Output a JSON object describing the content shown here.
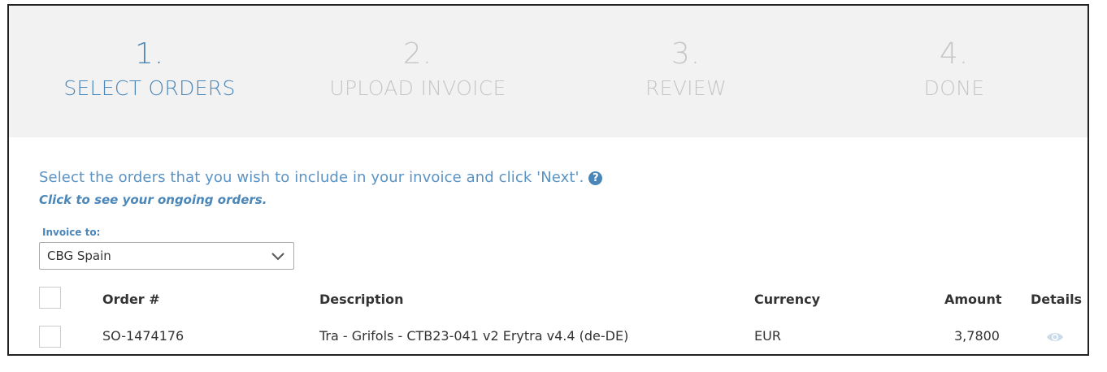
{
  "steps": [
    {
      "number": "1.",
      "label": "SELECT ORDERS",
      "active": true
    },
    {
      "number": "2.",
      "label": "UPLOAD INVOICE",
      "active": false
    },
    {
      "number": "3.",
      "label": "REVIEW",
      "active": false
    },
    {
      "number": "4.",
      "label": "DONE",
      "active": false
    }
  ],
  "intro": {
    "text": "Select the orders that you wish to include in your invoice and click 'Next'.",
    "help_icon": "question-circle-icon",
    "ongoing_link": "Click to see your ongoing orders."
  },
  "invoice_to": {
    "label": "Invoice to:",
    "selected": "CBG Spain"
  },
  "table": {
    "headers": {
      "order": "Order #",
      "description": "Description",
      "currency": "Currency",
      "amount": "Amount",
      "details": "Details"
    },
    "rows": [
      {
        "order": "SO-1474176",
        "description": "Tra - Grifols - CTB23-041 v2 Erytra v4.4 (de-DE)",
        "currency": "EUR",
        "amount": "3,7800",
        "details_icon": "eye-icon"
      }
    ]
  },
  "colors": {
    "accent": "#4a86b8",
    "inactive_step": "#c6c6c6",
    "steps_bg": "#f2f2f2"
  }
}
